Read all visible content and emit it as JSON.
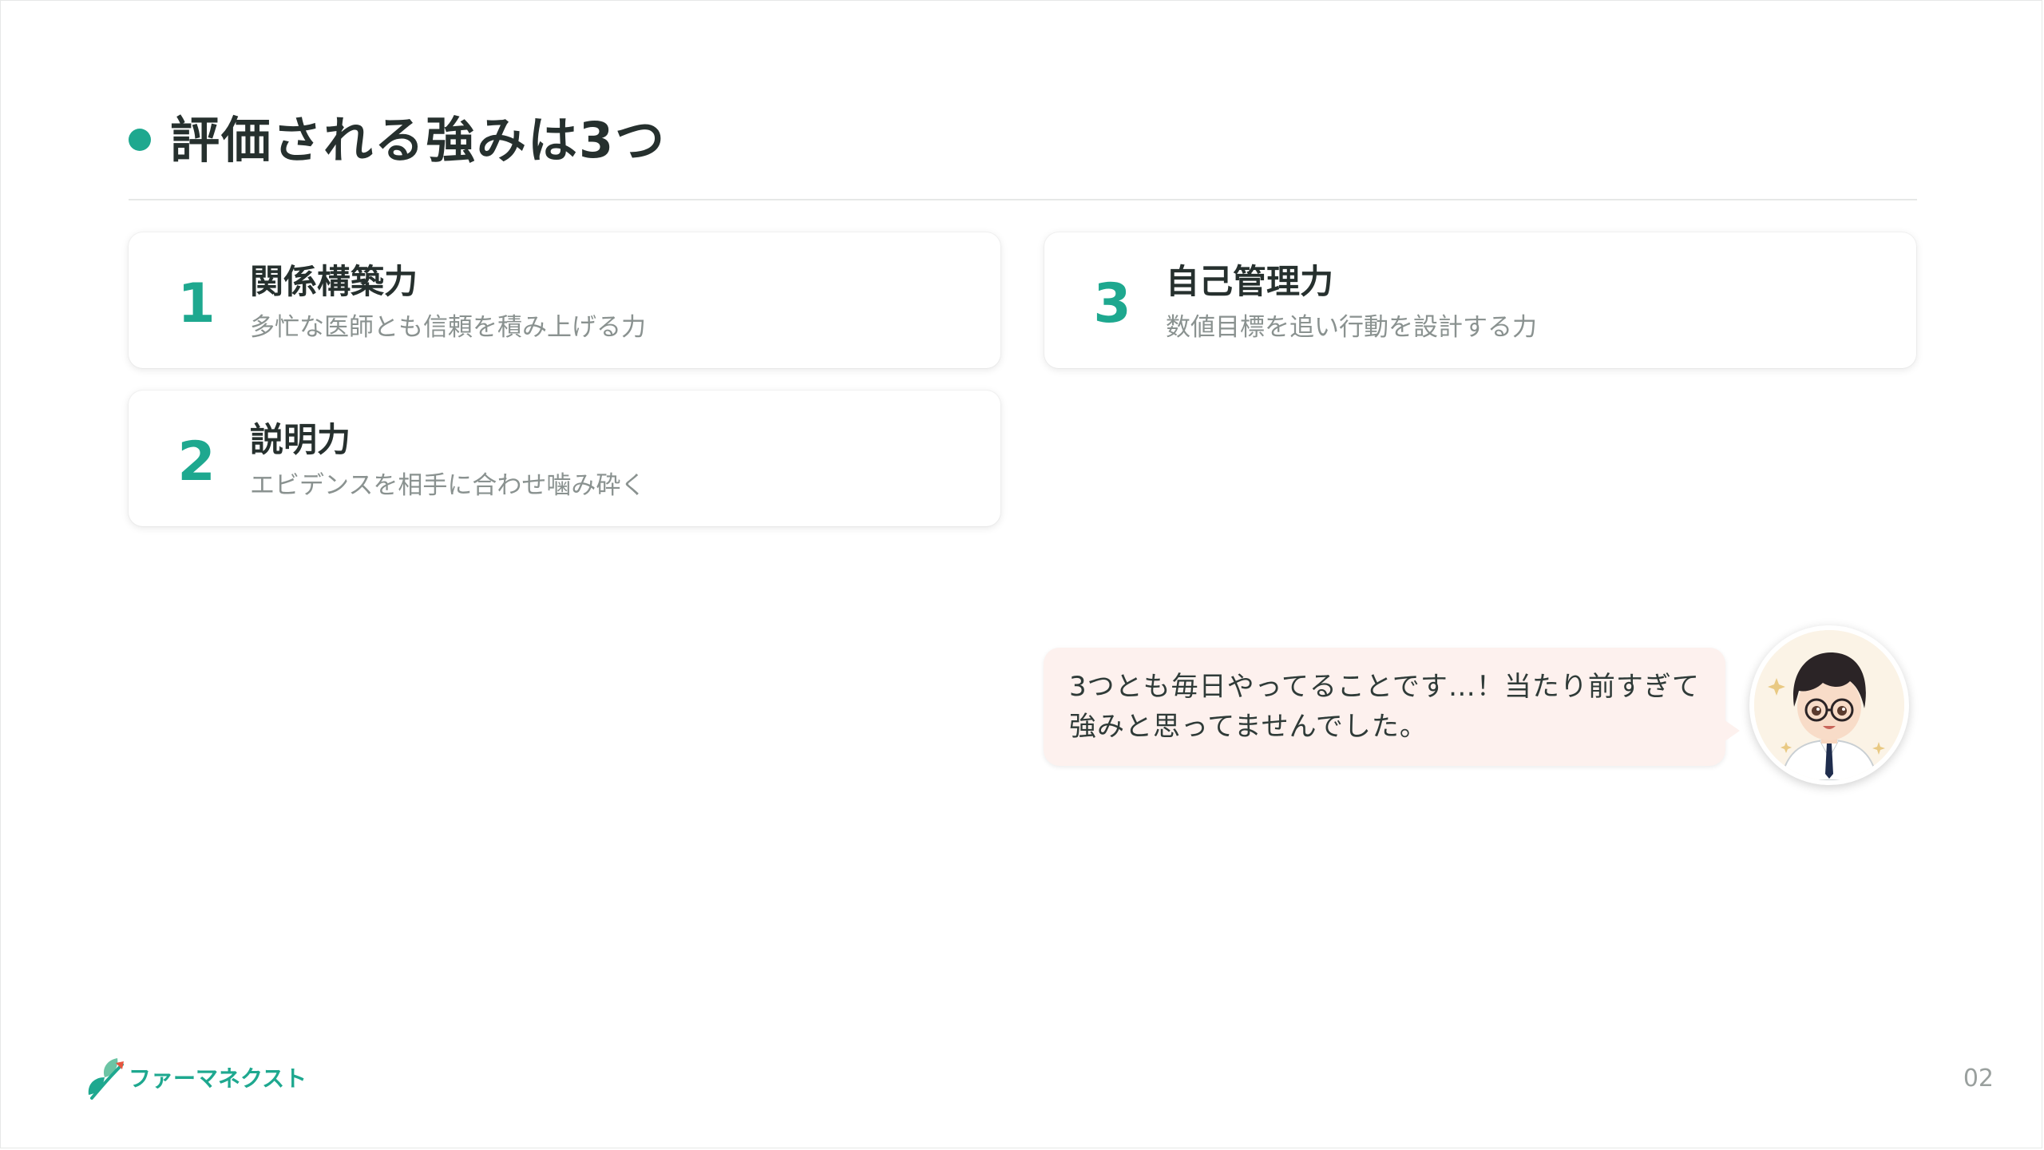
{
  "slide": {
    "title": "評価される強みは3つ",
    "page_number": "02"
  },
  "cards": [
    {
      "number": "1",
      "title": "関係構築力",
      "description": "多忙な医師とも信頼を積み上げる力"
    },
    {
      "number": "2",
      "title": "説明力",
      "description": "エビデンスを相手に合わせ噛み砕く"
    },
    {
      "number": "3",
      "title": "自己管理力",
      "description": "数値目標を追い行動を設計する力"
    }
  ],
  "speech": {
    "text": "3つとも毎日やってることです…！当たり前すぎて強みと思ってませんでした。"
  },
  "logo": {
    "text": "ファーマネクスト"
  },
  "colors": {
    "accent": "#1ea88f",
    "bubble": "#fdf1ee",
    "text": "#26302e",
    "muted": "#8a9290"
  }
}
